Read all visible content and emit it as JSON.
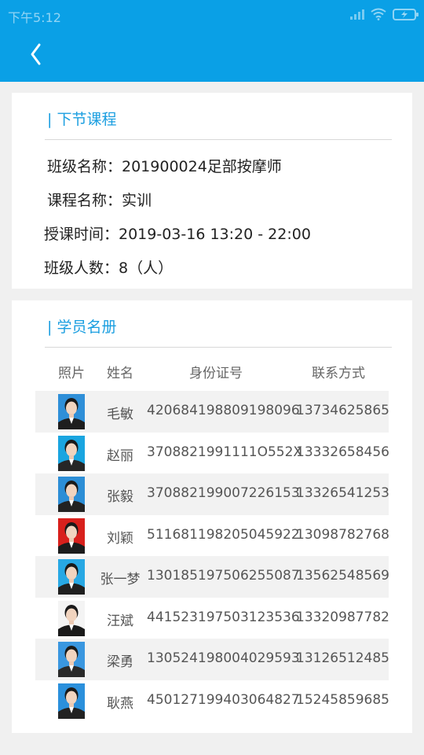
{
  "status_bar": {
    "time": "下午5:12"
  },
  "header": {
    "back_icon": "chevron-left-icon"
  },
  "next_course": {
    "title": "| 下节课程",
    "class_name_line": "班级名称：201900024足部按摩师",
    "course_name_line": "课程名称：实训",
    "time_line": "授课时间：2019-03-16  13:20 - 22:00",
    "count_line": "班级人数：8（人）"
  },
  "roster": {
    "title": "| 学员名册",
    "columns": [
      "照片",
      "姓名",
      "身份证号",
      "联系方式"
    ],
    "students": [
      {
        "name": "毛敏",
        "id": "420684198809198096",
        "phone": "13734625865",
        "bg": "#2f8fd8",
        "shirt": "#1e1e1e"
      },
      {
        "name": "赵丽",
        "id": "3708821991111O552X",
        "phone": "13332658456",
        "bg": "#1aa5e0",
        "shirt": "#262626"
      },
      {
        "name": "张毅",
        "id": "370882199007226153",
        "phone": "13326541253",
        "bg": "#2c8ed6",
        "shirt": "#222222"
      },
      {
        "name": "刘颖",
        "id": "511681198205045922",
        "phone": "13098782768",
        "bg": "#d8201c",
        "shirt": "#1c1c1c"
      },
      {
        "name": "张一梦",
        "id": "130185197506255087",
        "phone": "13562548569",
        "bg": "#28a8e4",
        "shirt": "#202020"
      },
      {
        "name": "汪斌",
        "id": "441523197503123536",
        "phone": "13320987782",
        "bg": "#f4f4f4",
        "shirt": "#1a1a1a"
      },
      {
        "name": "梁勇",
        "id": "130524198004029593",
        "phone": "13126512485",
        "bg": "#3a97e0",
        "shirt": "#2a2a2a"
      },
      {
        "name": "耿燕",
        "id": "450127199403064827",
        "phone": "15245859685",
        "bg": "#2b90dc",
        "shirt": "#222222"
      }
    ]
  },
  "colors": {
    "appbar": "#0aa0e6",
    "accent": "#1a9ee0",
    "background": "#f0f0f0"
  }
}
